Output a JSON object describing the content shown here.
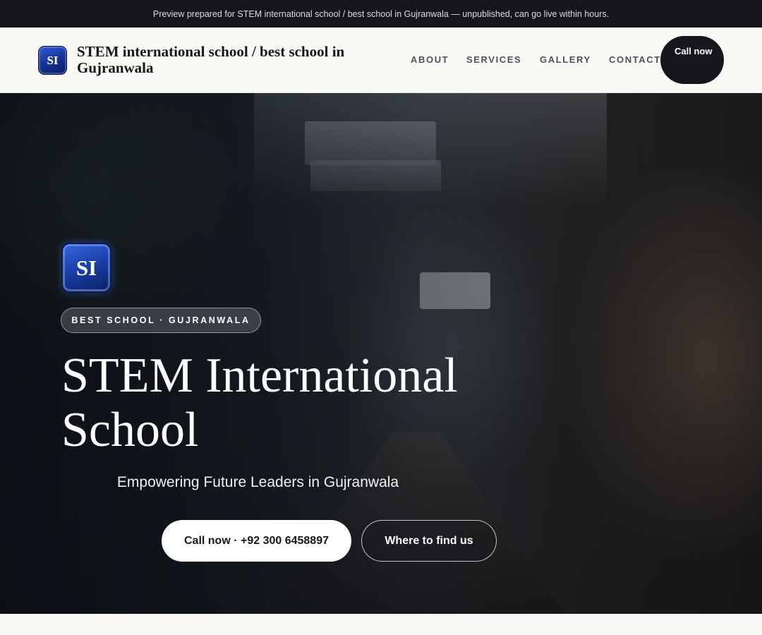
{
  "preview_banner": "Preview prepared for STEM international school / best school in Gujranwala — unpublished, can go live within hours.",
  "header": {
    "logo_initials": "SI",
    "brand_name": "STEM international school / best school in Gujranwala",
    "nav": [
      "ABOUT",
      "SERVICES",
      "GALLERY",
      "CONTACT"
    ],
    "call_button": "Call now"
  },
  "hero": {
    "badge_initials": "SI",
    "eyebrow": "BEST SCHOOL · GUJRANWALA",
    "title": "STEM International School",
    "subtitle": "Empowering Future Leaders in Gujranwala",
    "primary_button": "Call now · +92 300 6458897",
    "secondary_button": "Where to find us"
  },
  "colors": {
    "dark": "#15171c",
    "badge_blue": "#173a9e",
    "page_bg": "#faf9f6"
  }
}
